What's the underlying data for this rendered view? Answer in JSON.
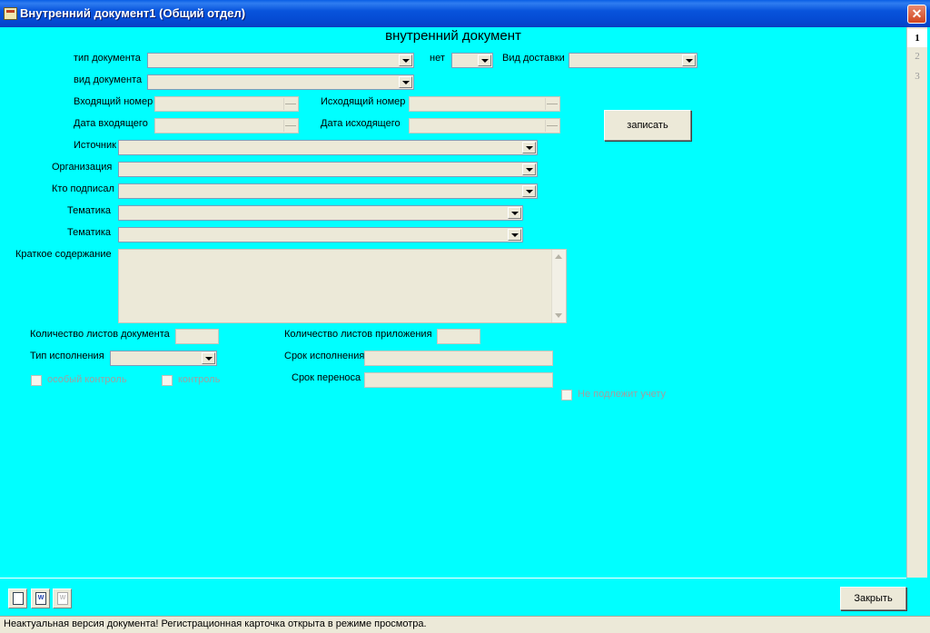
{
  "window": {
    "title": "Внутренний документ1 (Общий отдел)",
    "close_glyph": "✕"
  },
  "form": {
    "heading": "внутренний документ",
    "labels": {
      "doc_type": "тип документа",
      "net": "нет",
      "delivery": "Вид доставки",
      "doc_kind": "вид документа",
      "incoming_no": "Входящий номер",
      "outgoing_no": "Исходящий номер",
      "incoming_date": "Дата входящего",
      "outgoing_date": "Дата исходящего",
      "source": "Источник",
      "organization": "Организация",
      "signed_by": "Кто подписал",
      "topic1": "Тематика",
      "topic2": "Тематика",
      "summary": "Краткое содержание",
      "sheets_doc": "Количество листов документа",
      "sheets_attach": "Количество листов приложения",
      "exec_type": "Тип исполнения",
      "exec_deadline": "Срок исполнения",
      "postpone_deadline": "Срок переноса",
      "special_control": "особый контроль",
      "control": "контроль",
      "not_accounted": "Не подлежит учету"
    },
    "save_button": "записать"
  },
  "pager": [
    "1",
    "2",
    "3"
  ],
  "footer": {
    "close_button": "Закрыть",
    "tools": [
      "print-icon",
      "word-icon",
      "word-disabled-icon"
    ],
    "word_glyph": "W"
  },
  "status": {
    "text": "Неактуальная версия документа! Регистрационная карточка открыта в режиме просмотра."
  },
  "colors": {
    "client_bg": "#00ffff",
    "titlebar": "#0854dc"
  }
}
